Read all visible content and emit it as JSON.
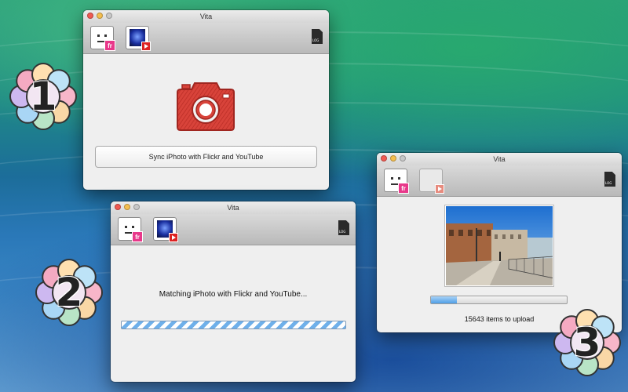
{
  "windows": [
    {
      "title": "Vita",
      "sync_button_label": "Sync iPhoto with Flickr and YouTube"
    },
    {
      "title": "Vita",
      "status_text": "Matching iPhoto with Flickr and YouTube..."
    },
    {
      "title": "Vita",
      "upload_count_text": "15643 items to upload",
      "upload_progress": 0.19
    }
  ],
  "toolbar": {
    "flickr_badge": "fr",
    "log_label": "LOG"
  },
  "steps": [
    "1",
    "2",
    "3"
  ],
  "colors": {
    "camera_red": "#d8433a",
    "progress_blue": "#6fb0ea"
  },
  "icons": [
    "flickr-service-icon",
    "youtube-service-icon",
    "log-file-icon",
    "camera-icon"
  ]
}
